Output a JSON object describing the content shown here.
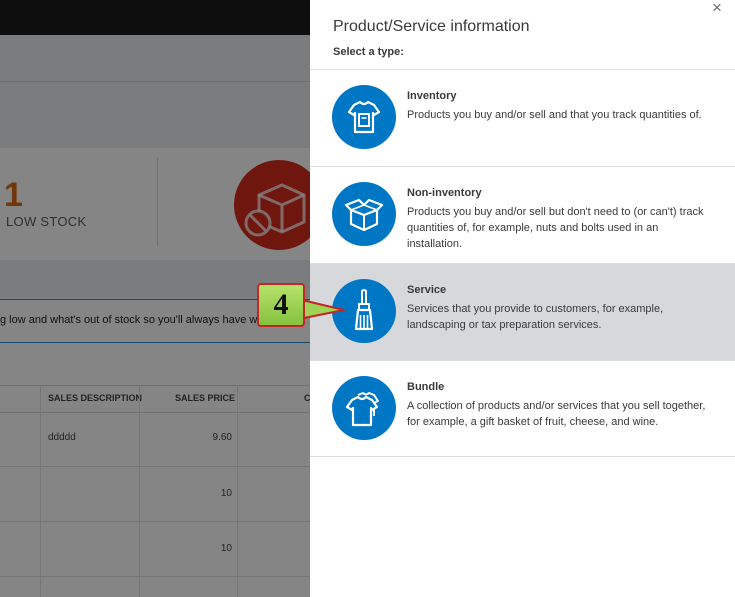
{
  "background": {
    "stock": {
      "count": "1",
      "label": "LOW STOCK"
    },
    "info_text": "g low and what's out of stock so you'll always have wh",
    "table": {
      "columns": [
        "SALES DESCRIPTION",
        "SALES PRICE",
        "C"
      ],
      "rows": [
        {
          "description": "ddddd",
          "price": "9.60"
        },
        {
          "description": "",
          "price": "10"
        },
        {
          "description": "",
          "price": "10"
        }
      ]
    }
  },
  "panel": {
    "title": "Product/Service information",
    "close_icon": "×",
    "subtitle": "Select a type:",
    "options": [
      {
        "name": "Inventory",
        "description": "Products you buy and/or sell and that you track quantities of.",
        "icon": "tshirt-tag-icon"
      },
      {
        "name": "Non-inventory",
        "description": "Products you buy and/or sell but don't need to (or can't) track quantities of, for example, nuts and bolts used in an installation.",
        "icon": "open-box-icon"
      },
      {
        "name": "Service",
        "description": "Services that you provide to customers, for example, landscaping or tax preparation services.",
        "icon": "paintbrush-icon",
        "selected": true
      },
      {
        "name": "Bundle",
        "description": "A collection of products and/or services that you sell together, for example, a gift basket of fruit, cheese, and wine.",
        "icon": "stacked-shirts-icon"
      }
    ]
  },
  "callout": {
    "step": "4"
  },
  "colors": {
    "accent": "#0077c5",
    "selected_bg": "#d6d8dc",
    "low_stock": "#d86a14",
    "callout_fill": "#9fd356",
    "callout_border": "#c22626"
  }
}
